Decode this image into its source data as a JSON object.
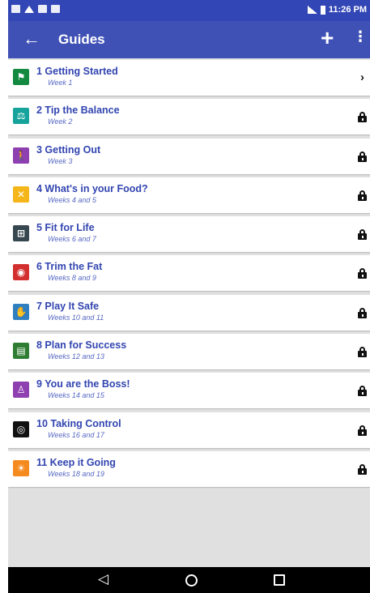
{
  "status_bar": {
    "time": "11:26 PM"
  },
  "app_bar": {
    "back_glyph": "←",
    "title": "Guides",
    "add_glyph": "+",
    "more_glyph": "⋮"
  },
  "guides": [
    {
      "title": "1 Getting Started",
      "subtitle": "Week 1",
      "icon": "flag-icon",
      "icon_glyph": "⚑",
      "icon_color": "#138a3f",
      "state": "open"
    },
    {
      "title": "2 Tip the Balance",
      "subtitle": "Week 2",
      "icon": "scale-icon",
      "icon_glyph": "⚖",
      "icon_color": "#15a39b",
      "state": "locked"
    },
    {
      "title": "3 Getting Out",
      "subtitle": "Week 3",
      "icon": "walking-person-icon",
      "icon_glyph": "🚶",
      "icon_color": "#8e3fb0",
      "state": "locked"
    },
    {
      "title": "4 What's in your Food?",
      "subtitle": "Weeks 4 and 5",
      "icon": "fork-knife-icon",
      "icon_glyph": "✕",
      "icon_color": "#f4b619",
      "state": "locked"
    },
    {
      "title": "5 Fit for Life",
      "subtitle": "Weeks 6 and 7",
      "icon": "dumbbell-icon",
      "icon_glyph": "⊞",
      "icon_color": "#37474f",
      "state": "locked"
    },
    {
      "title": "6 Trim the Fat",
      "subtitle": "Weeks 8 and 9",
      "icon": "steak-icon",
      "icon_glyph": "◉",
      "icon_color": "#d32f2f",
      "state": "locked"
    },
    {
      "title": "7 Play It Safe",
      "subtitle": "Weeks 10 and 11",
      "icon": "safety-person-icon",
      "icon_glyph": "✋",
      "icon_color": "#2f7fc1",
      "state": "locked"
    },
    {
      "title": "8 Plan for Success",
      "subtitle": "Weeks 12 and 13",
      "icon": "clipboard-icon",
      "icon_glyph": "▤",
      "icon_color": "#2e7d32",
      "state": "locked"
    },
    {
      "title": "9 You are the Boss!",
      "subtitle": "Weeks 14 and 15",
      "icon": "boss-person-icon",
      "icon_glyph": "♙",
      "icon_color": "#8e3fb0",
      "state": "locked"
    },
    {
      "title": "10 Taking Control",
      "subtitle": "Weeks 16 and 17",
      "icon": "steering-wheel-icon",
      "icon_glyph": "◎",
      "icon_color": "#111111",
      "state": "locked"
    },
    {
      "title": "11 Keep it Going",
      "subtitle": "Weeks 18 and 19",
      "icon": "sun-icon",
      "icon_glyph": "☀",
      "icon_color": "#f58a1f",
      "state": "locked"
    }
  ],
  "open_arrow": "›",
  "nav_bar": {
    "back_glyph": "◁"
  }
}
